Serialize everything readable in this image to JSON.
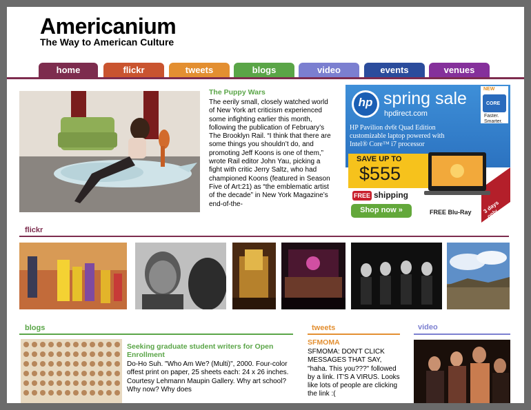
{
  "site": {
    "title": "Americanium",
    "tagline": "The Way to American Culture"
  },
  "nav": {
    "tabs": [
      {
        "label": "home",
        "color": "#7d2c4e"
      },
      {
        "label": "flickr",
        "color": "#c9542f"
      },
      {
        "label": "tweets",
        "color": "#e38f31"
      },
      {
        "label": "blogs",
        "color": "#5aa547"
      },
      {
        "label": "video",
        "color": "#7b7fd0"
      },
      {
        "label": "events",
        "color": "#2b4c9c"
      },
      {
        "label": "venues",
        "color": "#85309b"
      }
    ]
  },
  "feature": {
    "title": "The Puppy Wars",
    "body": "The eerily small, closely watched world of New York art criticism experienced some infighting earlier this month, following the publication of February’s The Brooklyn Rail. “I think that there are some things you shouldn’t do, and promoting Jeff Koons is one of them,” wrote Rail editor John Yau, picking a fight with critic Jerry Saltz, who had championed Koons (featured in Season Five of Art:21) as “the emblematic artist of the decade” in New York Magazine’s end-of-the-"
  },
  "ad": {
    "logo": "hp",
    "headline": "spring sale",
    "domain": "hpdirect.com",
    "product_line1": "HP Pavilion dv6t Quad Edition",
    "product_line2": "customizable laptop powered with",
    "product_line3": "Intel® Core™ i7 processor",
    "save_label": "SAVE UP TO",
    "save_amount": "$555",
    "free_badge": "FREE",
    "shipping": "shipping",
    "shop_button": "Shop now »",
    "bluray": "FREE Blu-Ray",
    "corner": "3 days only",
    "intel_badge_top": "NEW",
    "intel_badge_mid": "Intel",
    "intel_badge_core": "CORE",
    "intel_badge_i7": "i7",
    "intel_slogan1": "Faster.",
    "intel_slogan2": "Smarter."
  },
  "flickr": {
    "label": "flickr",
    "color": "#7d2c4e"
  },
  "blogs": {
    "label": "blogs",
    "color": "#5aa547",
    "post_title": "Seeking graduate student writers for Open Enrollment",
    "post_body": "Do-Ho Suh. \"Who Am We? (Multi)\", 2000. Four-color offest print on paper, 25 sheets each: 24 x 26 inches. Courtesy Lehmann Maupin Gallery. Why art school? Why now? Why does"
  },
  "tweets": {
    "label": "tweets",
    "color": "#e38f31",
    "user": "SFMOMA",
    "text": "SFMOMA: DON'T CLICK MESSAGES THAT SAY, \"haha. This you???\" followed by a link. IT'S A VIRUS. Looks like lots of people are clicking the link :("
  },
  "video": {
    "label": "video",
    "color": "#7b7fd0"
  }
}
